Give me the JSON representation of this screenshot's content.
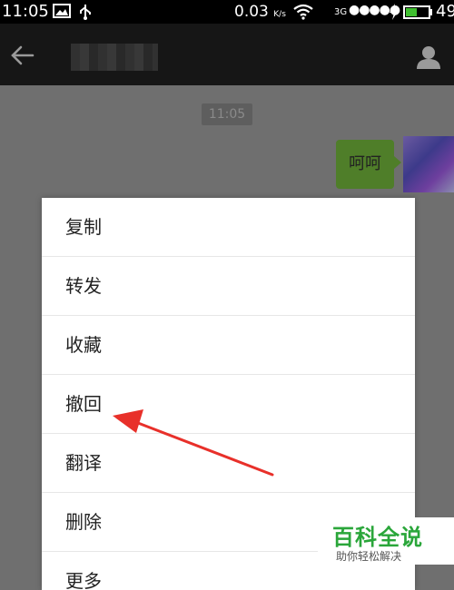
{
  "status_bar": {
    "time": "11:05",
    "net_speed": "0.03",
    "speed_unit": "K/s",
    "network": "3G",
    "signal_dots": "●●●●●",
    "battery": "49"
  },
  "app_bar": {
    "back_icon": "arrow-left-icon",
    "profile_icon": "person-icon"
  },
  "chat": {
    "timestamp": "11:05",
    "message": "呵呵"
  },
  "menu": {
    "items": [
      {
        "label": "复制"
      },
      {
        "label": "转发"
      },
      {
        "label": "收藏"
      },
      {
        "label": "撤回"
      },
      {
        "label": "翻译"
      },
      {
        "label": "删除"
      },
      {
        "label": "更多"
      }
    ]
  },
  "annotation": {
    "color": "#e8302a"
  },
  "watermark": {
    "title": "百科全说",
    "subtitle": "助你轻松解决",
    "color": "#2aa63a"
  }
}
